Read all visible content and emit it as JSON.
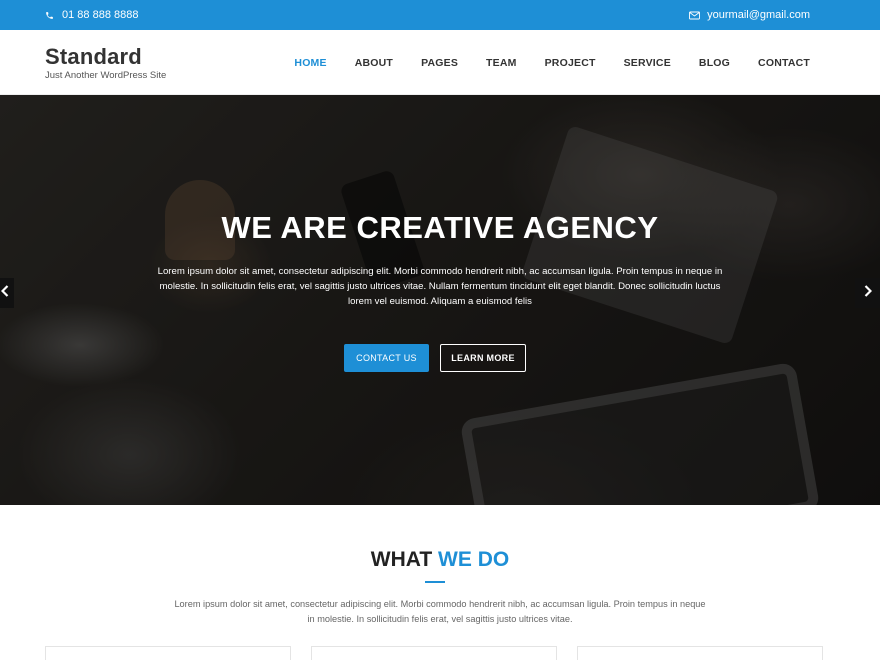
{
  "topbar": {
    "phone": "01 88 888 8888",
    "email": "yourmail@gmail.com",
    "phone_icon": "phone-icon",
    "email_icon": "envelope-icon"
  },
  "brand": {
    "title": "Standard",
    "tagline": "Just Another WordPress Site"
  },
  "nav": {
    "items": [
      "HOME",
      "ABOUT",
      "PAGES",
      "TEAM",
      "PROJECT",
      "SERVICE",
      "BLOG",
      "CONTACT"
    ],
    "active": "HOME"
  },
  "hero": {
    "title": "WE ARE CREATIVE AGENCY",
    "text": "Lorem ipsum dolor sit amet, consectetur adipiscing elit. Morbi commodo hendrerit nibh, ac accumsan ligula. Proin tempus in neque in molestie. In sollicitudin felis erat, vel sagittis justo ultrices vitae. Nullam fermentum tincidunt elit eget blandit. Donec sollicitudin luctus lorem vel euismod. Aliquam a euismod felis",
    "primary_button": "CONTACT US",
    "secondary_button": "LEARN MORE",
    "prev_icon": "chevron-left-icon",
    "next_icon": "chevron-right-icon"
  },
  "what_we_do": {
    "title_part1": "WHAT",
    "title_part2": "WE DO",
    "text": "Lorem ipsum dolor sit amet, consectetur adipiscing elit. Morbi commodo hendrerit nibh, ac accumsan ligula. Proin tempus in neque in molestie. In sollicitudin felis erat, vel sagittis justo ultrices vitae."
  },
  "colors": {
    "accent": "#1e8fd6",
    "heading": "#222222"
  }
}
